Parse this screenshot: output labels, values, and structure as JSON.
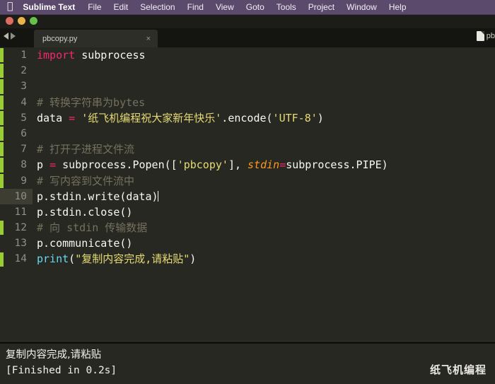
{
  "menubar": {
    "apple_icon": "apple-icon",
    "app_name": "Sublime Text",
    "items": [
      "File",
      "Edit",
      "Selection",
      "Find",
      "View",
      "Goto",
      "Tools",
      "Project",
      "Window",
      "Help"
    ]
  },
  "window": {
    "close_label": "",
    "minimize_label": "",
    "zoom_label": ""
  },
  "tabstrip": {
    "nav_back_icon": "arrow-left-icon",
    "nav_forward_icon": "arrow-right-icon",
    "tab_label": "pbcopy.py",
    "tab_close_label": "×",
    "file_icon": "file-icon",
    "file_name_clipped": "pb"
  },
  "editor": {
    "active_line": 10,
    "lines": [
      {
        "no": "1",
        "segments": [
          {
            "t": "import",
            "c": "kw"
          },
          {
            "t": " subprocess",
            "c": "plain"
          }
        ],
        "changed": true
      },
      {
        "no": "2",
        "segments": [],
        "changed": true
      },
      {
        "no": "3",
        "segments": [],
        "changed": true
      },
      {
        "no": "4",
        "segments": [
          {
            "t": "# 转换字符串为bytes",
            "c": "com"
          }
        ],
        "changed": true
      },
      {
        "no": "5",
        "segments": [
          {
            "t": "data ",
            "c": "plain"
          },
          {
            "t": "=",
            "c": "op"
          },
          {
            "t": " ",
            "c": "plain"
          },
          {
            "t": "'纸飞机编程祝大家新年快乐'",
            "c": "str"
          },
          {
            "t": ".encode(",
            "c": "plain"
          },
          {
            "t": "'UTF-8'",
            "c": "str"
          },
          {
            "t": ")",
            "c": "plain"
          }
        ],
        "changed": true
      },
      {
        "no": "6",
        "segments": [],
        "changed": true
      },
      {
        "no": "7",
        "segments": [
          {
            "t": "# 打开子进程文件流",
            "c": "com"
          }
        ],
        "changed": true
      },
      {
        "no": "8",
        "segments": [
          {
            "t": "p ",
            "c": "plain"
          },
          {
            "t": "=",
            "c": "op"
          },
          {
            "t": " subprocess.Popen([",
            "c": "plain"
          },
          {
            "t": "'pbcopy'",
            "c": "str"
          },
          {
            "t": "], ",
            "c": "plain"
          },
          {
            "t": "stdin",
            "c": "param"
          },
          {
            "t": "=",
            "c": "op"
          },
          {
            "t": "subprocess.PIPE)",
            "c": "plain"
          }
        ],
        "changed": true
      },
      {
        "no": "9",
        "segments": [
          {
            "t": "# 写内容到文件流中",
            "c": "com"
          }
        ],
        "changed": true
      },
      {
        "no": "10",
        "segments": [
          {
            "t": "p.stdin.write(data)",
            "c": "plain"
          }
        ],
        "changed": false,
        "caret_after": true
      },
      {
        "no": "11",
        "segments": [
          {
            "t": "p.stdin.close()",
            "c": "plain"
          }
        ],
        "changed": false
      },
      {
        "no": "12",
        "segments": [
          {
            "t": "# 向 stdin 传输数据",
            "c": "com"
          }
        ],
        "changed": true
      },
      {
        "no": "13",
        "segments": [
          {
            "t": "p.communicate()",
            "c": "plain"
          }
        ],
        "changed": false
      },
      {
        "no": "14",
        "segments": [
          {
            "t": "print",
            "c": "fn"
          },
          {
            "t": "(",
            "c": "plain"
          },
          {
            "t": "\"复制内容完成,请粘贴\"",
            "c": "str"
          },
          {
            "t": ")",
            "c": "plain"
          }
        ],
        "changed": true
      }
    ]
  },
  "console": {
    "output_line": "复制内容完成,请粘贴",
    "status_line": "[Finished in 0.2s]",
    "watermark": "纸飞机编程"
  },
  "colors": {
    "menubar_bg": "#5b4a6b",
    "editor_bg": "#272822",
    "keyword": "#f92672",
    "string": "#e6db74",
    "comment": "#75715e",
    "function": "#66d9ef",
    "parameter": "#fd971f",
    "foreground": "#f8f8f2",
    "active_line_gutter": "#3e3d32",
    "change_marker": "#9acd32"
  }
}
